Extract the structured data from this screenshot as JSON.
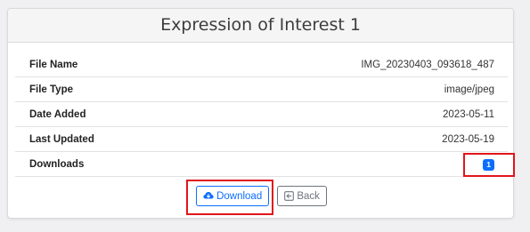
{
  "card": {
    "title": "Expression of Interest 1"
  },
  "details": [
    {
      "label": "File Name",
      "value": "IMG_20230403_093618_487"
    },
    {
      "label": "File Type",
      "value": "image/jpeg"
    },
    {
      "label": "Date Added",
      "value": "2023-05-11"
    },
    {
      "label": "Last Updated",
      "value": "2023-05-19"
    },
    {
      "label": "Downloads",
      "value": "1"
    }
  ],
  "actions": {
    "download_label": "Download",
    "back_label": "Back"
  },
  "icons": {
    "download": "cloud-download-icon",
    "back": "arrow-left-square-icon"
  },
  "colors": {
    "primary": "#0d6efd",
    "secondary": "#6c757d",
    "highlight": "#e0161a"
  }
}
